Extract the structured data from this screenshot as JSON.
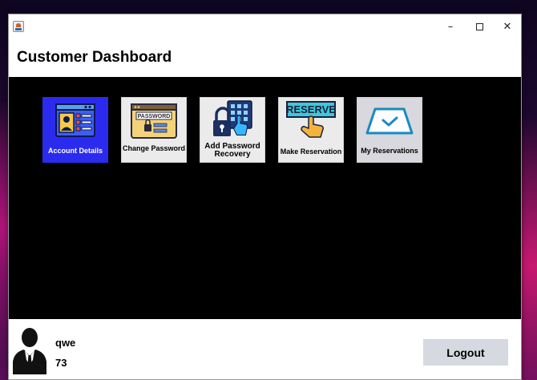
{
  "window": {
    "title": "",
    "controls": {
      "minimize": "–",
      "close": "✕"
    }
  },
  "header": {
    "title": "Customer Dashboard"
  },
  "tiles": [
    {
      "label": "Account Details",
      "icon": "account-details-icon",
      "state": "selected"
    },
    {
      "label": "Change Password",
      "icon": "password-form-icon"
    },
    {
      "label": "Add Password Recovery",
      "icon": "lock-keypad-icon"
    },
    {
      "label": "Make Reservation",
      "icon": "reserve-button-icon",
      "icon_text": "RESERVE"
    },
    {
      "label": "My Reservations",
      "icon": "ticket-check-icon"
    }
  ],
  "password_icon_text": "PASSWORD",
  "footer": {
    "user_name": "qwe",
    "user_id": "73",
    "logout_label": "Logout"
  },
  "colors": {
    "selected_tile": "#2b2bf0",
    "main_background": "#000000",
    "logout_button": "#d6d9e0"
  }
}
